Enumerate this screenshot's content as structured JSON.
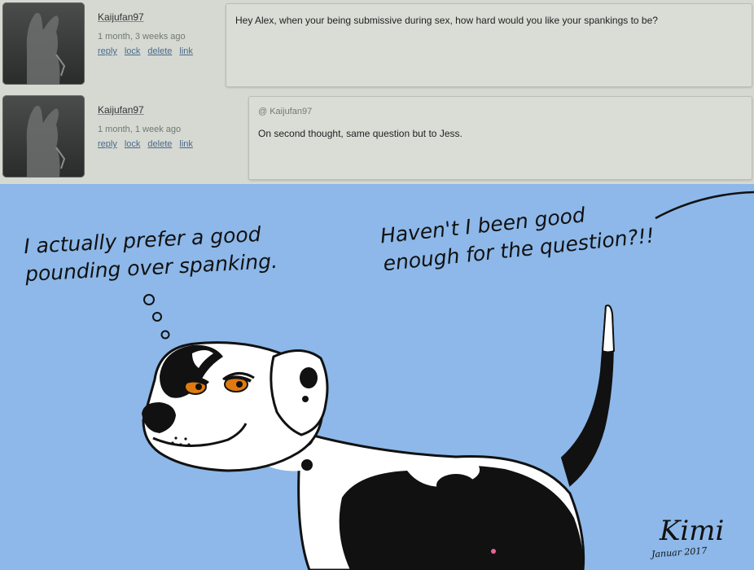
{
  "comments": [
    {
      "username": "Kaijufan97",
      "time": "1 month, 3 weeks ago",
      "actions": [
        "reply",
        "lock",
        "delete",
        "link"
      ],
      "message": "Hey Alex, when your being submissive during sex, how hard would you like your spankings to be?"
    },
    {
      "username": "Kaijufan97",
      "time": "1 month, 1 week ago",
      "actions": [
        "reply",
        "lock",
        "delete",
        "link"
      ],
      "quote_user": "@ Kaijufan97",
      "message": "On second thought, same question but to Jess."
    }
  ],
  "art": {
    "thought_text": "I actually prefer a good\npounding over spanking.",
    "speech_text": "Haven't I been good\nenough for the question?!!",
    "signature": "Kimi",
    "signature_date": "Januar 2017",
    "colors": {
      "background": "#8db8e9",
      "fur": "#ffffff",
      "spots": "#111111",
      "eye": "#e07a10"
    }
  }
}
